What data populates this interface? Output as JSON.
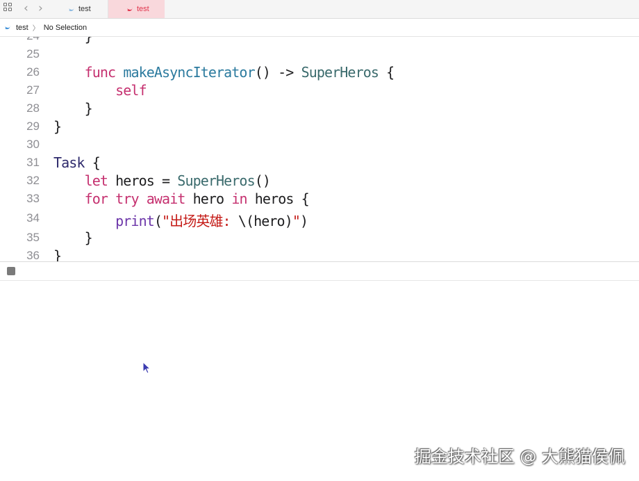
{
  "tabbar": {
    "tabs": [
      {
        "label": "test",
        "active": false
      },
      {
        "label": "test",
        "active": true
      }
    ]
  },
  "jumpbar": {
    "file": "test",
    "selection": "No Selection"
  },
  "editor": {
    "lines": [
      {
        "number": "24",
        "text": "    }"
      },
      {
        "number": "25",
        "text": ""
      },
      {
        "number": "26",
        "text": "    func makeAsyncIterator() -> SuperHeros {"
      },
      {
        "number": "27",
        "text": "        self"
      },
      {
        "number": "28",
        "text": "    }"
      },
      {
        "number": "29",
        "text": "}"
      },
      {
        "number": "30",
        "text": ""
      },
      {
        "number": "31",
        "text": "Task {"
      },
      {
        "number": "32",
        "text": "    let heros = SuperHeros()"
      },
      {
        "number": "33",
        "text": "    for try await hero in heros {"
      },
      {
        "number": "34",
        "text": "        print(\"出场英雄: \\(hero)\")"
      },
      {
        "number": "35",
        "text": "    }"
      },
      {
        "number": "36",
        "text": "}"
      }
    ]
  },
  "watermark": "掘金技术社区 @ 大熊猫侯佩",
  "colors": {
    "keyword": "#c5306f",
    "function": "#2b7a9e",
    "type": "#3a6a6c",
    "string": "#c41a16",
    "active_tab_bg": "#f9d8dc",
    "active_tab_text": "#e0344c"
  },
  "icons": [
    "grid-icon",
    "chevron-left-icon",
    "chevron-right-icon",
    "swift-icon",
    "stop-icon",
    "cursor-icon"
  ]
}
